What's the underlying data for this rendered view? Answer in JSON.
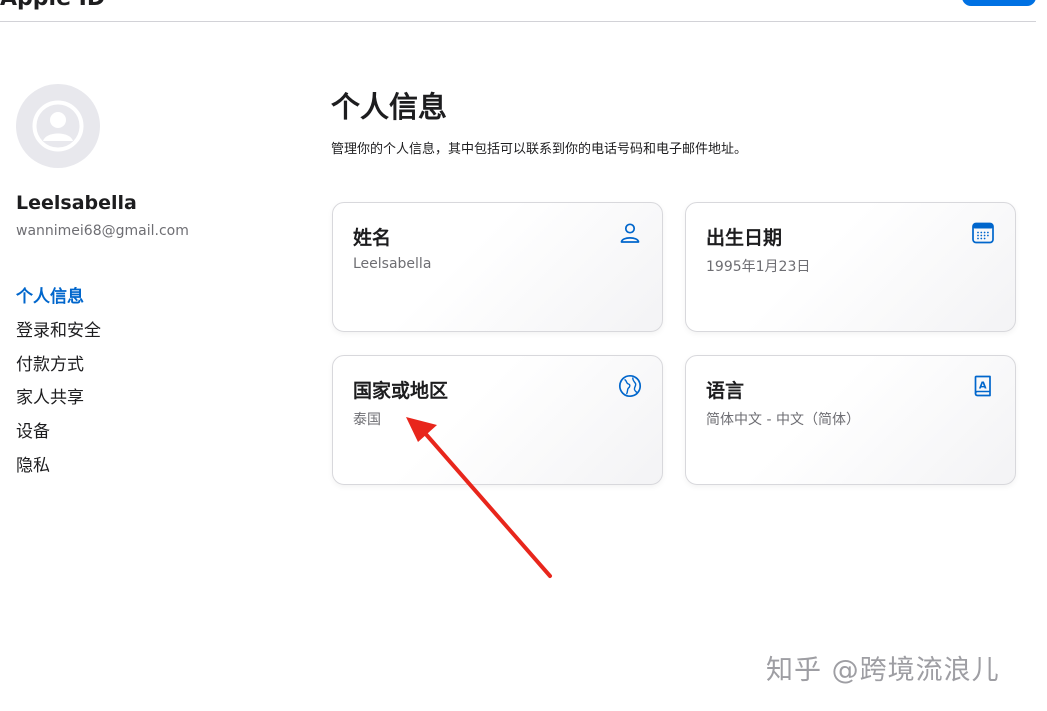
{
  "header": {
    "title": "Apple ID"
  },
  "user": {
    "name": "Leelsabella",
    "email": "wannimei68@gmail.com"
  },
  "nav": {
    "items": [
      {
        "label": "个人信息",
        "active": true
      },
      {
        "label": "登录和安全"
      },
      {
        "label": "付款方式"
      },
      {
        "label": "家人共享"
      },
      {
        "label": "设备"
      },
      {
        "label": "隐私"
      }
    ]
  },
  "main": {
    "title": "个人信息",
    "description": "管理你的个人信息，其中包括可以联系到你的电话号码和电子邮件地址。",
    "cards": {
      "name": {
        "title": "姓名",
        "value": "Leelsabella",
        "icon": "person-icon"
      },
      "birthday": {
        "title": "出生日期",
        "value": "1995年1月23日",
        "icon": "calendar-icon"
      },
      "region": {
        "title": "国家或地区",
        "value": "泰国",
        "icon": "globe-icon"
      },
      "language": {
        "title": "语言",
        "value": "简体中文 - 中文（简体）",
        "icon": "book-icon"
      }
    }
  },
  "watermark": "知乎 @跨境流浪儿",
  "colors": {
    "accent": "#0066cc",
    "annotation_arrow": "#e8261c"
  }
}
